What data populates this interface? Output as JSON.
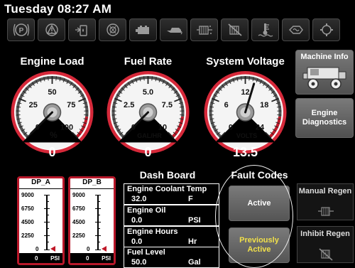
{
  "status_bar": {
    "datetime": "Tuesday 08:27 AM"
  },
  "indicators": [
    {
      "icon": "parking-brake-icon"
    },
    {
      "icon": "warning-triangle-icon"
    },
    {
      "icon": "fuel-filter-water-icon"
    },
    {
      "icon": "air-filter-icon"
    },
    {
      "icon": "battery-charge-icon"
    },
    {
      "icon": "oil-pressure-icon"
    },
    {
      "icon": "dpf-icon"
    },
    {
      "icon": "dpf-disabled-icon"
    },
    {
      "icon": "coolant-temp-icon"
    },
    {
      "icon": "glow-plug-icon"
    },
    {
      "icon": "engine-check-icon"
    }
  ],
  "gauges": [
    {
      "id": "engine-load",
      "title": "Engine Load",
      "min": 0,
      "max": 100,
      "value": 0,
      "readout": "0",
      "ticks": [
        "0",
        "25",
        "50",
        "75",
        "100"
      ],
      "unit": "%"
    },
    {
      "id": "fuel-rate",
      "title": "Fuel Rate",
      "min": 0,
      "max": 10,
      "value": 0,
      "readout": "0",
      "ticks": [
        "0",
        "2.5",
        "5.0",
        "7.5",
        "10"
      ],
      "unit": "GAL/HR"
    },
    {
      "id": "system-voltage",
      "title": "System Voltage",
      "min": 0,
      "max": 24,
      "value": 13.5,
      "readout": "13.5",
      "ticks": [
        "0",
        "6",
        "12",
        "18",
        "24"
      ],
      "unit": "VOLTS"
    }
  ],
  "side_buttons": {
    "machine_info": "Machine Info",
    "engine_diagnostics": "Engine Diagnostics"
  },
  "dp_gauges": [
    {
      "title": "DP_A",
      "ticks": [
        "9000",
        "6750",
        "4500",
        "2250",
        "0"
      ],
      "value": "0",
      "unit": "PSI"
    },
    {
      "title": "DP_B",
      "ticks": [
        "9000",
        "6750",
        "4500",
        "2250",
        "0"
      ],
      "value": "0",
      "unit": "PSI"
    }
  ],
  "dashboard": {
    "title": "Dash Board",
    "items": [
      {
        "name": "Engine Coolant Temp",
        "value": "32.0",
        "unit": "F"
      },
      {
        "name": "Engine Oil",
        "value": "0.0",
        "unit": "PSI"
      },
      {
        "name": "Engine Hours",
        "value": "0.0",
        "unit": "Hr"
      },
      {
        "name": "Fuel Level",
        "value": "50.0",
        "unit": "Gal"
      }
    ]
  },
  "fault_codes": {
    "title": "Fault Codes",
    "active": "Active",
    "previously_active": "Previously Active"
  },
  "regen": {
    "manual": "Manual Regen",
    "inhibit": "Inhibit Regen"
  },
  "colors": {
    "accent_red": "#c01828",
    "dial_red": "#d6293a",
    "prev_active_yellow": "#f1e04a"
  }
}
